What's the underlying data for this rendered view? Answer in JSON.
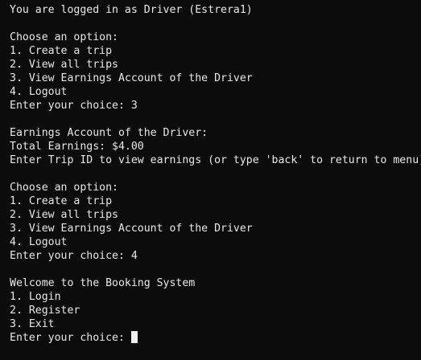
{
  "terminal": {
    "lines": [
      "You are logged in as Driver (Estrera1)",
      "",
      "Choose an option:",
      "1. Create a trip",
      "2. View all trips",
      "3. View Earnings Account of the Driver",
      "4. Logout",
      "Enter your choice: 3",
      "",
      "Earnings Account of the Driver:",
      "Total Earnings: $4.00",
      "Enter Trip ID to view earnings (or type 'back' to return to menu): back",
      "",
      "Choose an option:",
      "1. Create a trip",
      "2. View all trips",
      "3. View Earnings Account of the Driver",
      "4. Logout",
      "Enter your choice: 4",
      "",
      "Welcome to the Booking System",
      "1. Login",
      "2. Register",
      "3. Exit"
    ],
    "prompt": "Enter your choice: "
  }
}
